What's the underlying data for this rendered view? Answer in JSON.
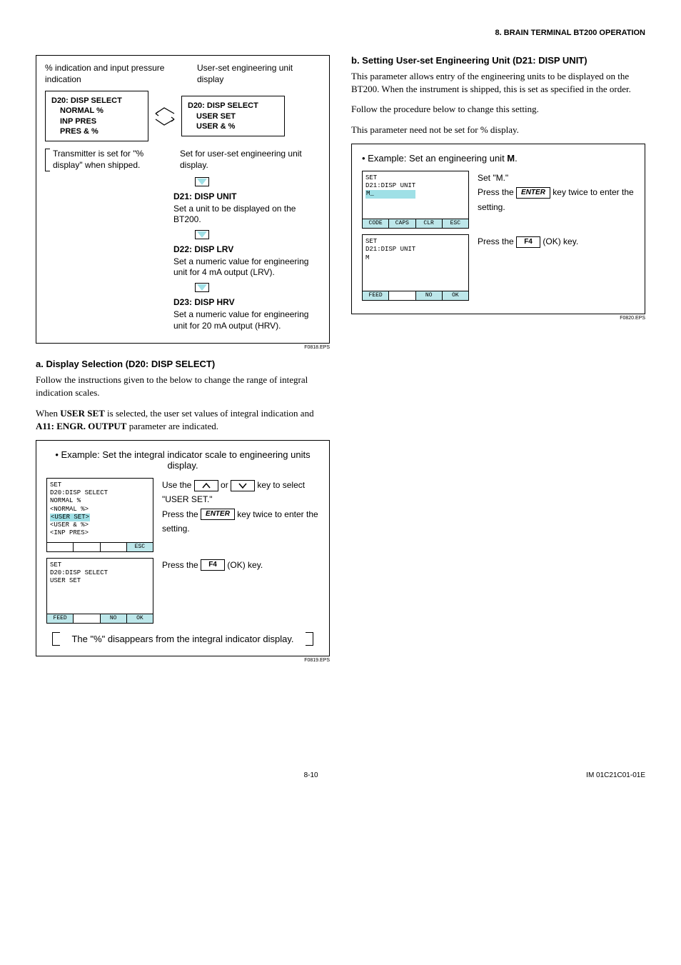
{
  "header": {
    "chapter": "8.  BRAIN TERMINAL BT200 OPERATION"
  },
  "leftDiagram": {
    "topLeft": "% indication and input pressure indication",
    "topRight": "User-set engineering unit display",
    "screenLeft": [
      "D20: DISP SELECT",
      "NORMAL %",
      "INP PRES",
      "PRES & %"
    ],
    "screenRight": [
      "D20: DISP SELECT",
      "USER SET",
      "USER & %"
    ],
    "note": "Transmitter is set for \"% display\" when shipped.",
    "rightNote": "Set for user-set engineering unit display.",
    "steps": [
      {
        "title": "D21: DISP UNIT",
        "desc": "Set a unit to be displayed on the BT200."
      },
      {
        "title": "D22: DISP LRV",
        "desc": "Set a numeric value for engineering unit for 4 mA output (LRV)."
      },
      {
        "title": "D23: DISP HRV",
        "desc": "Set a numeric value for engineering unit for 20 mA output (HRV)."
      }
    ],
    "eps": "F0818.EPS"
  },
  "sectionA": {
    "heading": "a.  Display Selection (D20: DISP SELECT)",
    "para1": "Follow the instructions given to the below to change the range of integral indication scales.",
    "para2_a": "When ",
    "para2_b": "USER SET",
    "para2_c": " is selected, the user set values of integral indication and ",
    "para2_d": "A11: ENGR. OUTPUT",
    "para2_e": " parameter are indicated."
  },
  "exampleA": {
    "title": "• Example: Set the integral indicator scale to engineering units display.",
    "panel1": {
      "lines": [
        "SET",
        " D20:DISP SELECT",
        "   NORMAL %",
        "  <NORMAL %>"
      ],
      "hlLines": [
        "  <USER SET>"
      ],
      "post": [
        "  <USER & %>",
        "  <INP PRES>"
      ],
      "footer": [
        "",
        "",
        "",
        "ESC"
      ]
    },
    "panel2": {
      "lines": [
        "SET",
        " D20:DISP SELECT",
        "   USER SET",
        "",
        "",
        "",
        ""
      ],
      "footer": [
        "FEED",
        "",
        "NO",
        "OK"
      ]
    },
    "desc1a": "Use the ",
    "desc1b": " or ",
    "desc1c": " key to select \"USER SET.\"",
    "desc2a": "Press the ",
    "desc2b": " key twice to enter the setting.",
    "desc3a": "Press the ",
    "desc3b": " (OK) key.",
    "keyEnter": "ENTER",
    "keyF4": "F4",
    "footnote": "The \"%\" disappears from the integral indicator display.",
    "eps": "F0819.EPS"
  },
  "sectionB": {
    "heading": "b.  Setting User-set Engineering Unit (D21: DISP UNIT)",
    "para1": "This parameter allows entry of the engineering units to be displayed on the BT200. When the instrument is shipped, this is set as specified in the order.",
    "para2": "Follow the procedure below to change this setting.",
    "para3": "This parameter need not be set for % display."
  },
  "exampleB": {
    "title_a": "• Example: Set an engineering unit ",
    "title_b": "M",
    "title_c": ".",
    "panel1": {
      "lines": [
        "SET",
        " D21:DISP UNIT"
      ],
      "input": "  M_",
      "footer": [
        "CODE",
        "CAPS",
        "CLR",
        "ESC"
      ]
    },
    "panel2": {
      "lines": [
        "SET",
        " D21:DISP UNIT",
        "   M",
        "",
        "",
        ""
      ],
      "footer": [
        "FEED",
        "",
        "NO",
        "OK"
      ]
    },
    "desc1": "Set \"M.\"",
    "desc2a": "Press the ",
    "desc2b": " key twice to enter the setting.",
    "desc3a": "Press the ",
    "desc3b": " (OK) key.",
    "keyEnter": "ENTER",
    "keyF4": "F4",
    "eps": "F0820.EPS"
  },
  "footer": {
    "page": "8-10",
    "doc": "IM 01C21C01-01E"
  }
}
